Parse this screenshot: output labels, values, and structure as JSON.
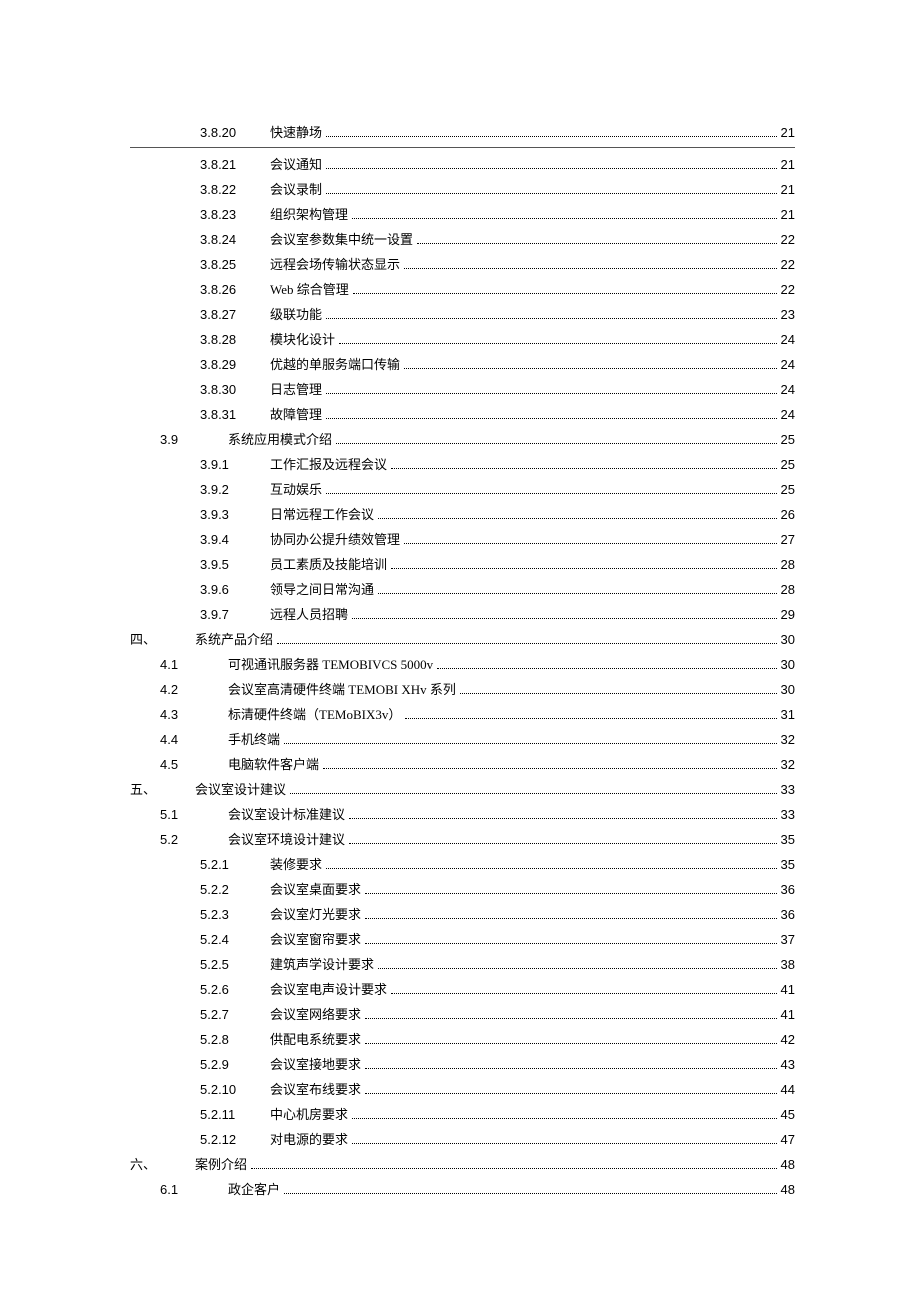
{
  "toc": [
    {
      "level": 3,
      "num": "3.8.20",
      "title": "快速静场",
      "page": "21",
      "first": true
    },
    {
      "level": 3,
      "num": "3.8.21",
      "title": "会议通知",
      "page": "21"
    },
    {
      "level": 3,
      "num": "3.8.22",
      "title": "会议录制",
      "page": "21"
    },
    {
      "level": 3,
      "num": "3.8.23",
      "title": "组织架构管理",
      "page": "21"
    },
    {
      "level": 3,
      "num": "3.8.24",
      "title": "会议室参数集中统一设置",
      "page": "22"
    },
    {
      "level": 3,
      "num": "3.8.25",
      "title": "远程会场传输状态显示",
      "page": "22"
    },
    {
      "level": 3,
      "num": "3.8.26",
      "title": "Web 综合管理",
      "page": "22"
    },
    {
      "level": 3,
      "num": "3.8.27",
      "title": "级联功能",
      "page": "23"
    },
    {
      "level": 3,
      "num": "3.8.28",
      "title": "模块化设计",
      "page": "24"
    },
    {
      "level": 3,
      "num": "3.8.29",
      "title": "优越的单服务端口传输",
      "page": "24"
    },
    {
      "level": 3,
      "num": "3.8.30",
      "title": "日志管理",
      "page": "24"
    },
    {
      "level": 3,
      "num": "3.8.31",
      "title": "故障管理",
      "page": "24"
    },
    {
      "level": 2,
      "num": "3.9",
      "title": "系统应用模式介绍",
      "page": "25"
    },
    {
      "level": 3,
      "num": "3.9.1",
      "title": "工作汇报及远程会议",
      "page": "25"
    },
    {
      "level": 3,
      "num": "3.9.2",
      "title": "互动娱乐",
      "page": "25"
    },
    {
      "level": 3,
      "num": "3.9.3",
      "title": "日常远程工作会议",
      "page": "26"
    },
    {
      "level": 3,
      "num": "3.9.4",
      "title": "协同办公提升绩效管理",
      "page": "27"
    },
    {
      "level": 3,
      "num": "3.9.5",
      "title": "员工素质及技能培训",
      "page": "28"
    },
    {
      "level": 3,
      "num": "3.9.6",
      "title": "领导之间日常沟通",
      "page": "28"
    },
    {
      "level": 3,
      "num": "3.9.7",
      "title": "远程人员招聘",
      "page": "29"
    },
    {
      "level": 1,
      "num": "四、",
      "title": "系统产品介绍",
      "page": "30"
    },
    {
      "level": 2,
      "num": "4.1",
      "title": "可视通讯服务器 TEMOBIVCS   5000v",
      "page": "30"
    },
    {
      "level": 2,
      "num": "4.2",
      "title": "会议室高清硬件终端 TEMOBI  XHv 系列",
      "page": "30"
    },
    {
      "level": 2,
      "num": "4.3",
      "title": "标清硬件终端（TEMoBIX3v）",
      "page": "31"
    },
    {
      "level": 2,
      "num": "4.4",
      "title": "手机终端",
      "page": "32"
    },
    {
      "level": 2,
      "num": "4.5",
      "title": "电脑软件客户端",
      "page": "32"
    },
    {
      "level": 1,
      "num": "五、",
      "title": "会议室设计建议",
      "page": "33"
    },
    {
      "level": 2,
      "num": "5.1",
      "title": "会议室设计标准建议",
      "page": "33"
    },
    {
      "level": 2,
      "num": "5.2",
      "title": "会议室环境设计建议",
      "page": "35"
    },
    {
      "level": 3,
      "num": "5.2.1",
      "title": "装修要求",
      "page": "35"
    },
    {
      "level": 3,
      "num": "5.2.2",
      "title": "会议室桌面要求",
      "page": "36"
    },
    {
      "level": 3,
      "num": "5.2.3",
      "title": "会议室灯光要求",
      "page": "36"
    },
    {
      "level": 3,
      "num": "5.2.4",
      "title": "会议室窗帘要求",
      "page": "37"
    },
    {
      "level": 3,
      "num": "5.2.5",
      "title": "建筑声学设计要求",
      "page": "38"
    },
    {
      "level": 3,
      "num": "5.2.6",
      "title": "会议室电声设计要求",
      "page": "41"
    },
    {
      "level": 3,
      "num": "5.2.7",
      "title": "会议室网络要求",
      "page": "41"
    },
    {
      "level": 3,
      "num": "5.2.8",
      "title": "供配电系统要求",
      "page": "42"
    },
    {
      "level": 3,
      "num": "5.2.9",
      "title": "会议室接地要求",
      "page": "43"
    },
    {
      "level": 3,
      "num": "5.2.10",
      "title": "会议室布线要求",
      "page": "44"
    },
    {
      "level": 3,
      "num": "5.2.11",
      "title": "中心机房要求",
      "page": "45"
    },
    {
      "level": 3,
      "num": "5.2.12",
      "title": "对电源的要求",
      "page": "47"
    },
    {
      "level": 1,
      "num": "六、",
      "title": "案例介绍",
      "page": "48"
    },
    {
      "level": 2,
      "num": "6.1",
      "title": "政企客户",
      "page": "48"
    }
  ]
}
